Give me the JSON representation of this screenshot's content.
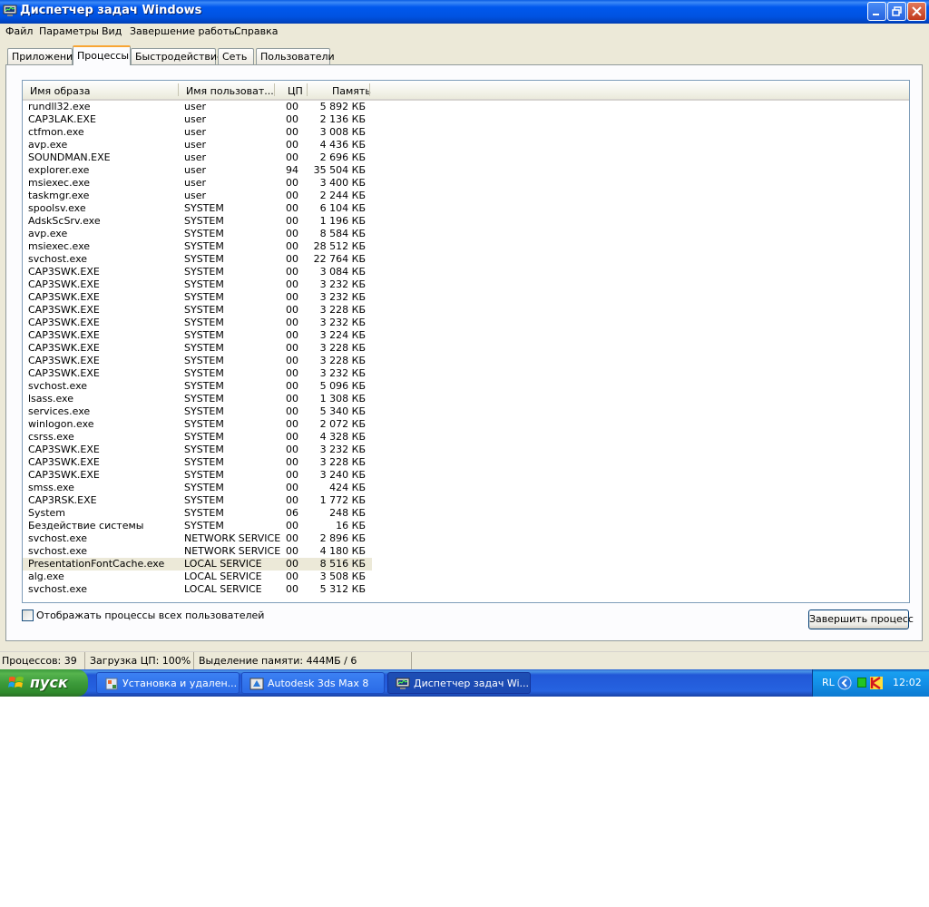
{
  "window": {
    "title": "Диспетчер задач Windows",
    "icon": "taskmgr-icon"
  },
  "menu": [
    "Файл",
    "Параметры",
    "Вид",
    "Завершение работы",
    "Справка"
  ],
  "tabs": [
    "Приложения",
    "Процессы",
    "Быстродействие",
    "Сеть",
    "Пользователи"
  ],
  "active_tab": "Процессы",
  "table": {
    "headers": [
      "Имя образа",
      "Имя пользоват...",
      "ЦП",
      "Память"
    ],
    "rows": [
      [
        "rundll32.exe",
        "user",
        "00",
        "5 892 КБ"
      ],
      [
        "CAP3LAK.EXE",
        "user",
        "00",
        "2 136 КБ"
      ],
      [
        "ctfmon.exe",
        "user",
        "00",
        "3 008 КБ"
      ],
      [
        "avp.exe",
        "user",
        "00",
        "4 436 КБ"
      ],
      [
        "SOUNDMAN.EXE",
        "user",
        "00",
        "2 696 КБ"
      ],
      [
        "explorer.exe",
        "user",
        "94",
        "35 504 КБ"
      ],
      [
        "msiexec.exe",
        "user",
        "00",
        "3 400 КБ"
      ],
      [
        "taskmgr.exe",
        "user",
        "00",
        "2 244 КБ"
      ],
      [
        "spoolsv.exe",
        "SYSTEM",
        "00",
        "6 104 КБ"
      ],
      [
        "AdskScSrv.exe",
        "SYSTEM",
        "00",
        "1 196 КБ"
      ],
      [
        "avp.exe",
        "SYSTEM",
        "00",
        "8 584 КБ"
      ],
      [
        "msiexec.exe",
        "SYSTEM",
        "00",
        "28 512 КБ"
      ],
      [
        "svchost.exe",
        "SYSTEM",
        "00",
        "22 764 КБ"
      ],
      [
        "CAP3SWK.EXE",
        "SYSTEM",
        "00",
        "3 084 КБ"
      ],
      [
        "CAP3SWK.EXE",
        "SYSTEM",
        "00",
        "3 232 КБ"
      ],
      [
        "CAP3SWK.EXE",
        "SYSTEM",
        "00",
        "3 232 КБ"
      ],
      [
        "CAP3SWK.EXE",
        "SYSTEM",
        "00",
        "3 228 КБ"
      ],
      [
        "CAP3SWK.EXE",
        "SYSTEM",
        "00",
        "3 232 КБ"
      ],
      [
        "CAP3SWK.EXE",
        "SYSTEM",
        "00",
        "3 224 КБ"
      ],
      [
        "CAP3SWK.EXE",
        "SYSTEM",
        "00",
        "3 228 КБ"
      ],
      [
        "CAP3SWK.EXE",
        "SYSTEM",
        "00",
        "3 228 КБ"
      ],
      [
        "CAP3SWK.EXE",
        "SYSTEM",
        "00",
        "3 232 КБ"
      ],
      [
        "svchost.exe",
        "SYSTEM",
        "00",
        "5 096 КБ"
      ],
      [
        "lsass.exe",
        "SYSTEM",
        "00",
        "1 308 КБ"
      ],
      [
        "services.exe",
        "SYSTEM",
        "00",
        "5 340 КБ"
      ],
      [
        "winlogon.exe",
        "SYSTEM",
        "00",
        "2 072 КБ"
      ],
      [
        "csrss.exe",
        "SYSTEM",
        "00",
        "4 328 КБ"
      ],
      [
        "CAP3SWK.EXE",
        "SYSTEM",
        "00",
        "3 232 КБ"
      ],
      [
        "CAP3SWK.EXE",
        "SYSTEM",
        "00",
        "3 228 КБ"
      ],
      [
        "CAP3SWK.EXE",
        "SYSTEM",
        "00",
        "3 240 КБ"
      ],
      [
        "smss.exe",
        "SYSTEM",
        "00",
        "424 КБ"
      ],
      [
        "CAP3RSK.EXE",
        "SYSTEM",
        "00",
        "1 772 КБ"
      ],
      [
        "System",
        "SYSTEM",
        "06",
        "248 КБ"
      ],
      [
        "Бездействие системы",
        "SYSTEM",
        "00",
        "16 КБ"
      ],
      [
        "svchost.exe",
        "NETWORK SERVICE",
        "00",
        "2 896 КБ"
      ],
      [
        "svchost.exe",
        "NETWORK SERVICE",
        "00",
        "4 180 КБ"
      ],
      [
        "PresentationFontCache.exe",
        "LOCAL SERVICE",
        "00",
        "8 516 КБ"
      ],
      [
        "alg.exe",
        "LOCAL SERVICE",
        "00",
        "3 508 КБ"
      ],
      [
        "svchost.exe",
        "LOCAL SERVICE",
        "00",
        "5 312 КБ"
      ]
    ],
    "selected_row": "PresentationFontCache.exe"
  },
  "show_all_checkbox": {
    "label": "Отображать процессы всех пользователей",
    "checked": false
  },
  "end_process_button": "Завершить процесс",
  "status": {
    "processes": "Процессов: 39",
    "cpu": "Загрузка ЦП: 100%",
    "memory": "Выделение памяти: 444МБ / 6"
  },
  "taskbar": {
    "start_label": "пуск",
    "tasks": [
      {
        "label": "Установка и удален...",
        "icon": "control-panel-icon",
        "active": false
      },
      {
        "label": "Autodesk 3ds Max 8",
        "icon": "3dsmax-icon",
        "active": false
      },
      {
        "label": "Диспетчер задач Wi...",
        "icon": "taskmgr-icon",
        "active": true
      }
    ],
    "tray": {
      "lang": "RL",
      "clock": "12:02"
    }
  },
  "colors": {
    "titlebar": "#0058ee",
    "selected_row": "#ece9d8",
    "taskbar": "#2663e0",
    "start_button": "#3d9b3b"
  }
}
